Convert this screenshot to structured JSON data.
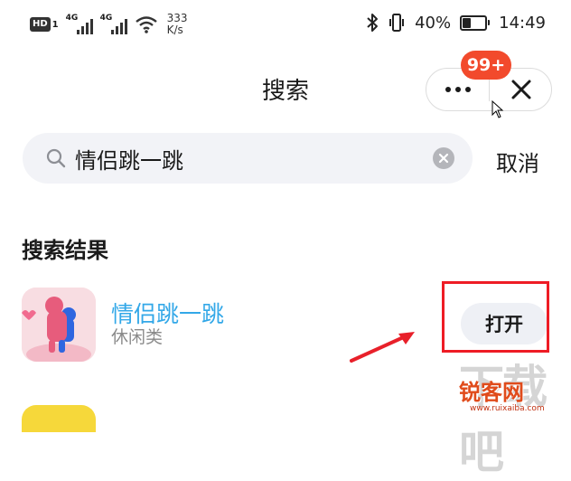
{
  "status_bar": {
    "hd_label": "HD",
    "hd_sub": "1",
    "sim1_tag": "4G",
    "sim2_tag": "4G",
    "net_speed_value": "333",
    "net_speed_unit": "K/s",
    "battery_text": "40%",
    "battery_level": 0.4,
    "time": "14:49",
    "icons": [
      "bluetooth-icon",
      "vibrate-icon",
      "wifi-icon",
      "battery-icon"
    ]
  },
  "header": {
    "title": "搜索",
    "notification_badge": "99+",
    "more_icon": "more-icon",
    "close_icon": "close-icon"
  },
  "search": {
    "value": "情侣跳一跳",
    "search_icon": "search-icon",
    "clear_icon": "clear-icon",
    "cancel_label": "取消"
  },
  "results": {
    "section_title": "搜索结果",
    "items": [
      {
        "name": "情侣跳一跳",
        "category": "休闲类",
        "action_label": "打开"
      }
    ]
  },
  "watermark": {
    "big": "下载吧",
    "small": "锐客网",
    "url": "www.ruixaiba.com"
  },
  "colors": {
    "accent_blue": "#33a8e8",
    "badge_red": "#f24a2c",
    "highlight_red": "#ee1c25",
    "search_bg": "#f2f3f7"
  }
}
